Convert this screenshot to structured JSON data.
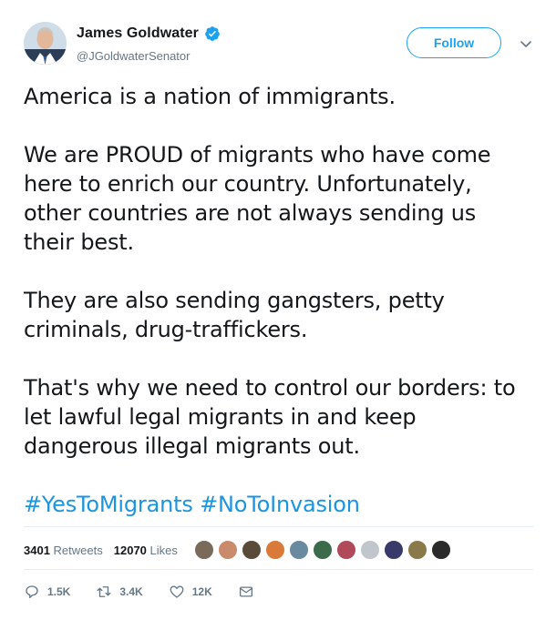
{
  "author": {
    "display_name": "James Goldwater",
    "handle": "@JGoldwaterSenator",
    "verified": true
  },
  "follow_label": "Follow",
  "tweet": {
    "paragraphs": [
      "America is a nation of immigrants.",
      "We are PROUD of migrants who have come\nhere to enrich our country. Unfortunately,\nother countries are not always sending us\ntheir best.",
      "They are also sending gangsters, petty\ncriminals, drug-traffickers.",
      "That's why we need to control our borders: to\nlet lawful legal migrants in and keep\ndangerous illegal migrants out."
    ],
    "hashtags": [
      "#YesToMigrants",
      "#NoToInvasion"
    ]
  },
  "stats": {
    "retweets_count": "3401",
    "retweets_label": "Retweets",
    "likes_count": "12070",
    "likes_label": "Likes"
  },
  "likers": [
    {
      "color": "#7a6a5a"
    },
    {
      "color": "#c98b6b"
    },
    {
      "color": "#5a4a3a"
    },
    {
      "color": "#d97a3a"
    },
    {
      "color": "#6a8aa0"
    },
    {
      "color": "#3b6b4b"
    },
    {
      "color": "#b04a5a"
    },
    {
      "color": "#c0c6cc"
    },
    {
      "color": "#3a3a6a"
    },
    {
      "color": "#8a7a4a"
    },
    {
      "color": "#2a2a2a"
    }
  ],
  "actions": {
    "reply_count": "1.5K",
    "retweet_count": "3.4K",
    "like_count": "12K"
  },
  "colors": {
    "accent": "#1da1f2",
    "hashtag": "#1b95e0",
    "muted": "#657786",
    "divider": "#e6ecf0"
  }
}
